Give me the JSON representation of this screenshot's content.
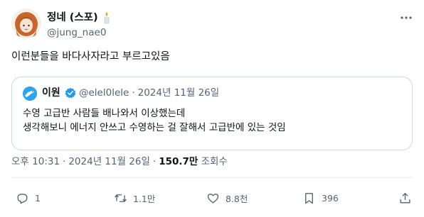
{
  "author": {
    "display_name": "정네 (스포)",
    "name_emoji_icon": "candle-icon",
    "handle": "@jung_nae0"
  },
  "tweet": {
    "text": "이런분들을 바다사자라고 부르고있음",
    "time": "오후 10:31",
    "date": "2024년 11월 26일",
    "views_count": "150.7만",
    "views_label": "조회수"
  },
  "quote": {
    "name": "이원",
    "verified_icon": "verified-badge-icon",
    "handle": "@elel0lele",
    "date": "2024년 11월 26일",
    "lines": [
      "수영 고급반 사람들 배나와서 이상했는데",
      "생각해보니 에너지 안쓰고 수영하는 걸 잘해서 고급반에 있는 것임"
    ]
  },
  "actions": {
    "replies": "1",
    "retweets": "1.1만",
    "likes": "8.8천",
    "bookmarks": "396"
  },
  "colors": {
    "text": "#0f1419",
    "secondary": "#536471",
    "border": "#cfd9de",
    "accent": "#1d9bf0"
  }
}
